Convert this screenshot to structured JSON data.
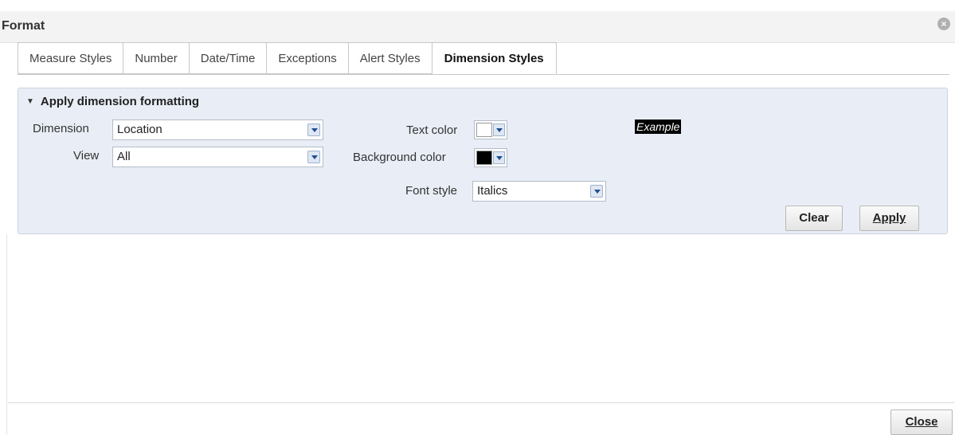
{
  "dialog": {
    "title": "Format",
    "close_icon": "close-circle-icon"
  },
  "tabs": [
    {
      "label": "Measure Styles"
    },
    {
      "label": "Number"
    },
    {
      "label": "Date/Time"
    },
    {
      "label": "Exceptions"
    },
    {
      "label": "Alert Styles"
    },
    {
      "label": "Dimension Styles",
      "active": true
    }
  ],
  "panel": {
    "header": "Apply dimension formatting",
    "dimension_label": "Dimension",
    "dimension_value": "Location",
    "view_label": "View",
    "view_value": "All",
    "text_color_label": "Text color",
    "text_color": "#ffffff",
    "background_color_label": "Background color",
    "background_color": "#000000",
    "font_style_label": "Font style",
    "font_style_value": "Italics",
    "example_text": "Example",
    "clear_label": "Clear",
    "apply_label": "Apply"
  },
  "footer": {
    "close_label": "Close"
  }
}
